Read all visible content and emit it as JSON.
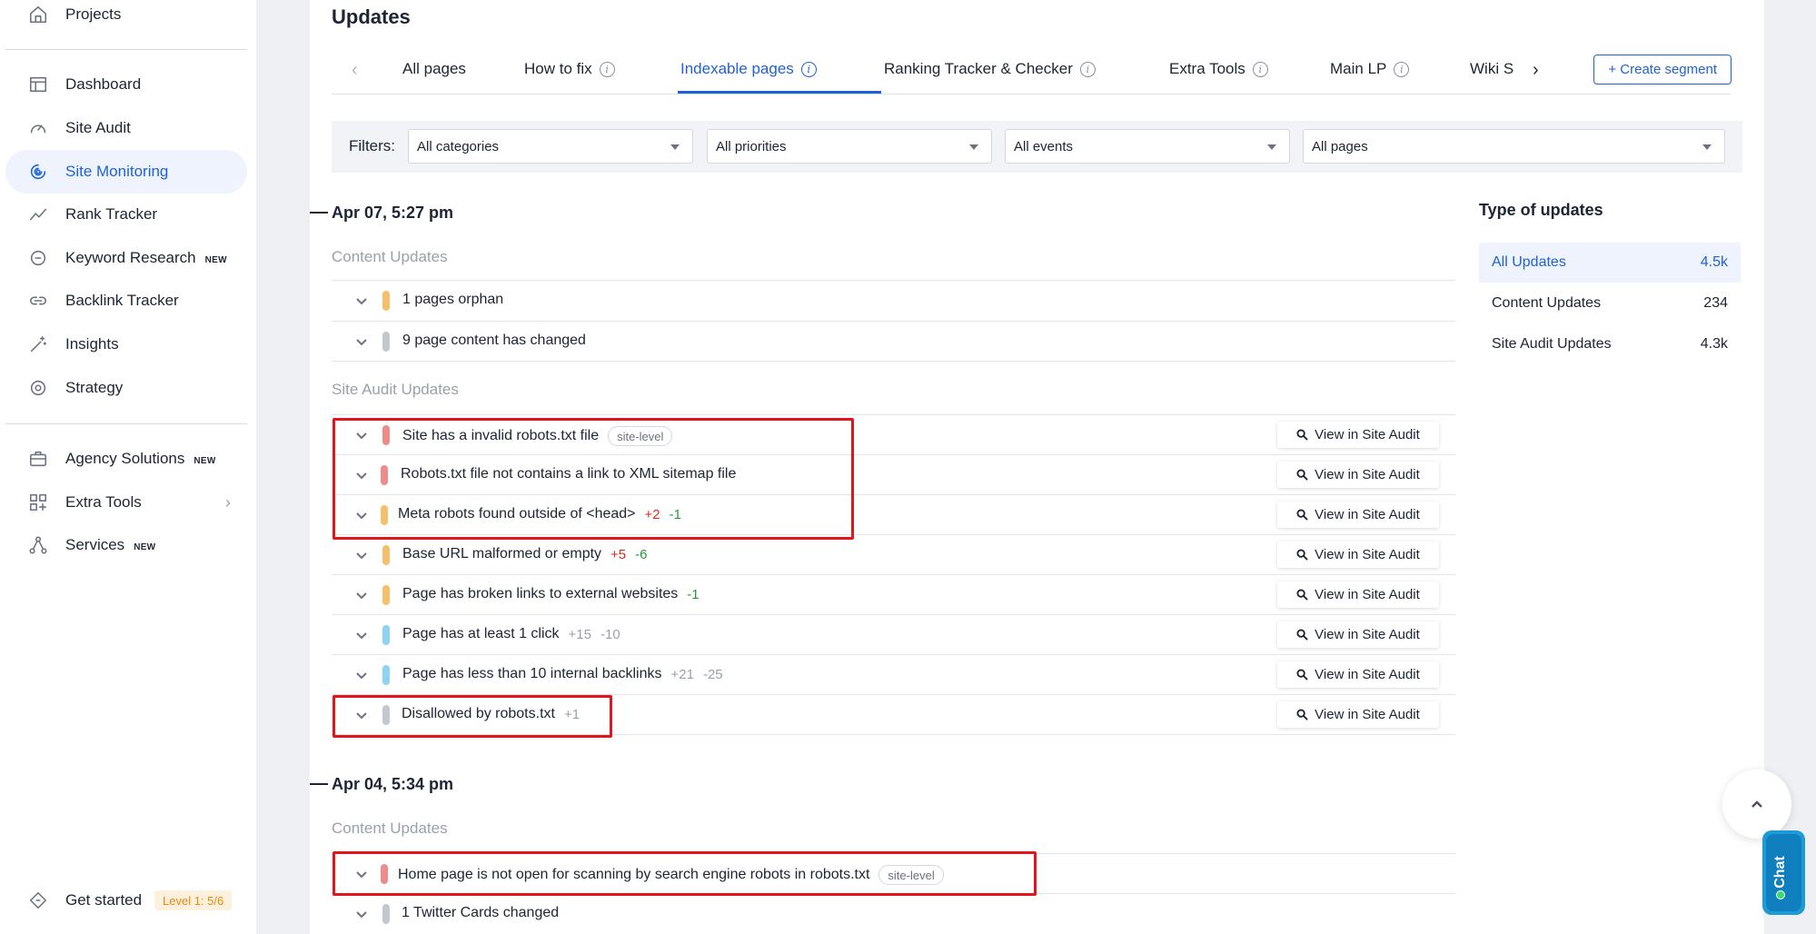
{
  "sidebar": {
    "top_item": "Projects",
    "items": [
      {
        "label": "Dashboard"
      },
      {
        "label": "Site Audit"
      },
      {
        "label": "Site Monitoring"
      },
      {
        "label": "Rank Tracker"
      },
      {
        "label": "Keyword Research",
        "badge": "NEW"
      },
      {
        "label": "Backlink Tracker"
      },
      {
        "label": "Insights"
      },
      {
        "label": "Strategy"
      },
      {
        "label": "Agency Solutions",
        "badge": "NEW"
      },
      {
        "label": "Extra Tools"
      },
      {
        "label": "Services",
        "badge": "NEW"
      }
    ],
    "get_started": "Get started",
    "level": "Level 1: 5/6"
  },
  "main": {
    "title": "Updates",
    "tabs": [
      {
        "label": "All pages"
      },
      {
        "label": "How to fix"
      },
      {
        "label": "Indexable pages"
      },
      {
        "label": "Ranking Tracker & Checker"
      },
      {
        "label": "Extra Tools"
      },
      {
        "label": "Main LP"
      },
      {
        "label": "Wiki S"
      }
    ],
    "create_segment": "+ Create segment",
    "filters": {
      "label": "Filters:",
      "categories": "All categories",
      "priorities": "All priorities",
      "events": "All events",
      "pages": "All pages"
    },
    "view_label": "View in Site Audit",
    "groups": [
      {
        "date": "Apr 07, 5:27 pm",
        "content_label": "Content Updates",
        "content": [
          {
            "text": "1 pages orphan"
          },
          {
            "text": "9 page content has changed"
          }
        ],
        "audit_label": "Site Audit Updates",
        "audit": [
          {
            "text": "Site has a invalid robots.txt file",
            "tag": "site-level"
          },
          {
            "text": "Robots.txt file not contains a link to XML sitemap file"
          },
          {
            "text": "Meta robots found outside of <head>",
            "plus": "+2",
            "minus": "-1"
          },
          {
            "text": "Base URL malformed or empty",
            "plus": "+5",
            "minus": "-6"
          },
          {
            "text": "Page has broken links to external websites",
            "minus": "-1"
          },
          {
            "text": "Page has at least 1 click",
            "muted1": "+15",
            "muted2": "-10"
          },
          {
            "text": "Page has less than 10 internal backlinks",
            "muted1": "+21",
            "muted2": "-25"
          },
          {
            "text": "Disallowed by robots.txt",
            "muted1": "+1"
          }
        ]
      },
      {
        "date": "Apr 04, 5:34 pm",
        "content_label": "Content Updates",
        "content": [
          {
            "text": "Home page is not open for scanning by search engine robots in robots.txt",
            "tag": "site-level"
          },
          {
            "text": "1 Twitter Cards changed"
          }
        ]
      }
    ]
  },
  "types": {
    "title": "Type of updates",
    "items": [
      {
        "label": "All Updates",
        "count": "4.5k"
      },
      {
        "label": "Content Updates",
        "count": "234"
      },
      {
        "label": "Site Audit Updates",
        "count": "4.3k"
      }
    ]
  },
  "chat": "Chat",
  "colors": {
    "accent": "#1f61d6",
    "severity_red": "#f08b8b",
    "severity_orange": "#f6bf6b",
    "severity_gray": "#c3c8cf",
    "severity_blue": "#8fd3f2",
    "highlight": "#e4141c"
  }
}
